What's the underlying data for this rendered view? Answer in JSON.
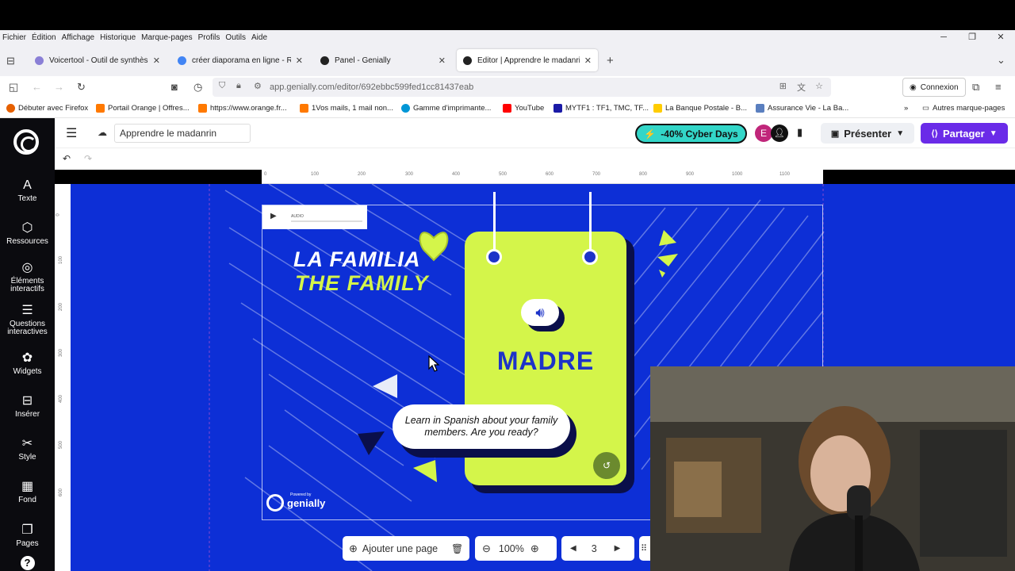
{
  "browser": {
    "menu": [
      "Fichier",
      "Édition",
      "Affichage",
      "Historique",
      "Marque-pages",
      "Profils",
      "Outils",
      "Aide"
    ],
    "tabs": [
      {
        "title": "Voicertool - Outil de synthèse v",
        "icon_color": "#8a7fd6",
        "active": false
      },
      {
        "title": "créer diaporama en ligne - Rech",
        "icon_color": "#4285f4",
        "active": false
      },
      {
        "title": "Panel - Genially",
        "icon_color": "#222222",
        "active": false
      },
      {
        "title": "Editor | Apprendre le madanrin",
        "icon_color": "#222222",
        "active": true
      }
    ],
    "url": "app.genially.com/editor/692ebbc599fed1cc81437eab",
    "connexion_label": "Connexion",
    "bookmarks": [
      {
        "label": "Débuter avec Firefox",
        "icon_color": "#e66000"
      },
      {
        "label": "Portail Orange | Offres...",
        "icon_color": "#ff7900"
      },
      {
        "label": "https://www.orange.fr...",
        "icon_color": "#ff7900"
      },
      {
        "label": "1Vos mails, 1 mail non...",
        "icon_color": "#ff7900"
      },
      {
        "label": "Gamme d'imprimante...",
        "icon_color": "#0096d6"
      },
      {
        "label": "YouTube",
        "icon_color": "#ff0000"
      },
      {
        "label": "MYTF1 : TF1, TMC, TF...",
        "icon_color": "#1a1aa6"
      },
      {
        "label": "La Banque Postale - B...",
        "icon_color": "#ffcc00"
      },
      {
        "label": "Assurance Vie - La Ba...",
        "icon_color": "#5a7fbf"
      }
    ],
    "other_bookmarks": "Autres marque-pages"
  },
  "editor": {
    "title": "Apprendre le madanrin",
    "promo_label": "-40% Cyber Days",
    "avatar_letter": "E",
    "present_label": "Présenter",
    "share_label": "Partager",
    "sidebar": [
      {
        "icon": "A",
        "label": "Texte"
      },
      {
        "icon": "⬡",
        "label": "Ressources"
      },
      {
        "icon": "◎",
        "label": "Éléments interactifs"
      },
      {
        "icon": "☰",
        "label": "Questions interactives"
      },
      {
        "icon": "✿",
        "label": "Widgets"
      },
      {
        "icon": "⊟",
        "label": "Insérer"
      },
      {
        "icon": "✂",
        "label": "Style"
      },
      {
        "icon": "▦",
        "label": "Fond"
      },
      {
        "icon": "❐",
        "label": "Pages"
      }
    ],
    "ruler_h": [
      "0",
      "100",
      "200",
      "300",
      "400",
      "500",
      "600",
      "700",
      "800",
      "900",
      "1000",
      "1100"
    ],
    "ruler_v": [
      "0",
      "100",
      "200",
      "300",
      "400",
      "500",
      "600"
    ]
  },
  "slide": {
    "audio_label": "AUDIO",
    "title_es": "LA FAMILIA",
    "title_en": "THE FAMILY",
    "card_word": "MADRE",
    "bubble_text": "Learn in Spanish about your family members. Are you ready?",
    "brand_small": "Powered by",
    "brand": "genially"
  },
  "bottom_toolbar": {
    "add_page_label": "Ajouter une page",
    "zoom": "100%",
    "page": "3"
  },
  "colors": {
    "workspace": "#0d2fd6",
    "lime": "#d4f54a",
    "accent": "#6a2be8",
    "promo": "#33d6c8"
  }
}
